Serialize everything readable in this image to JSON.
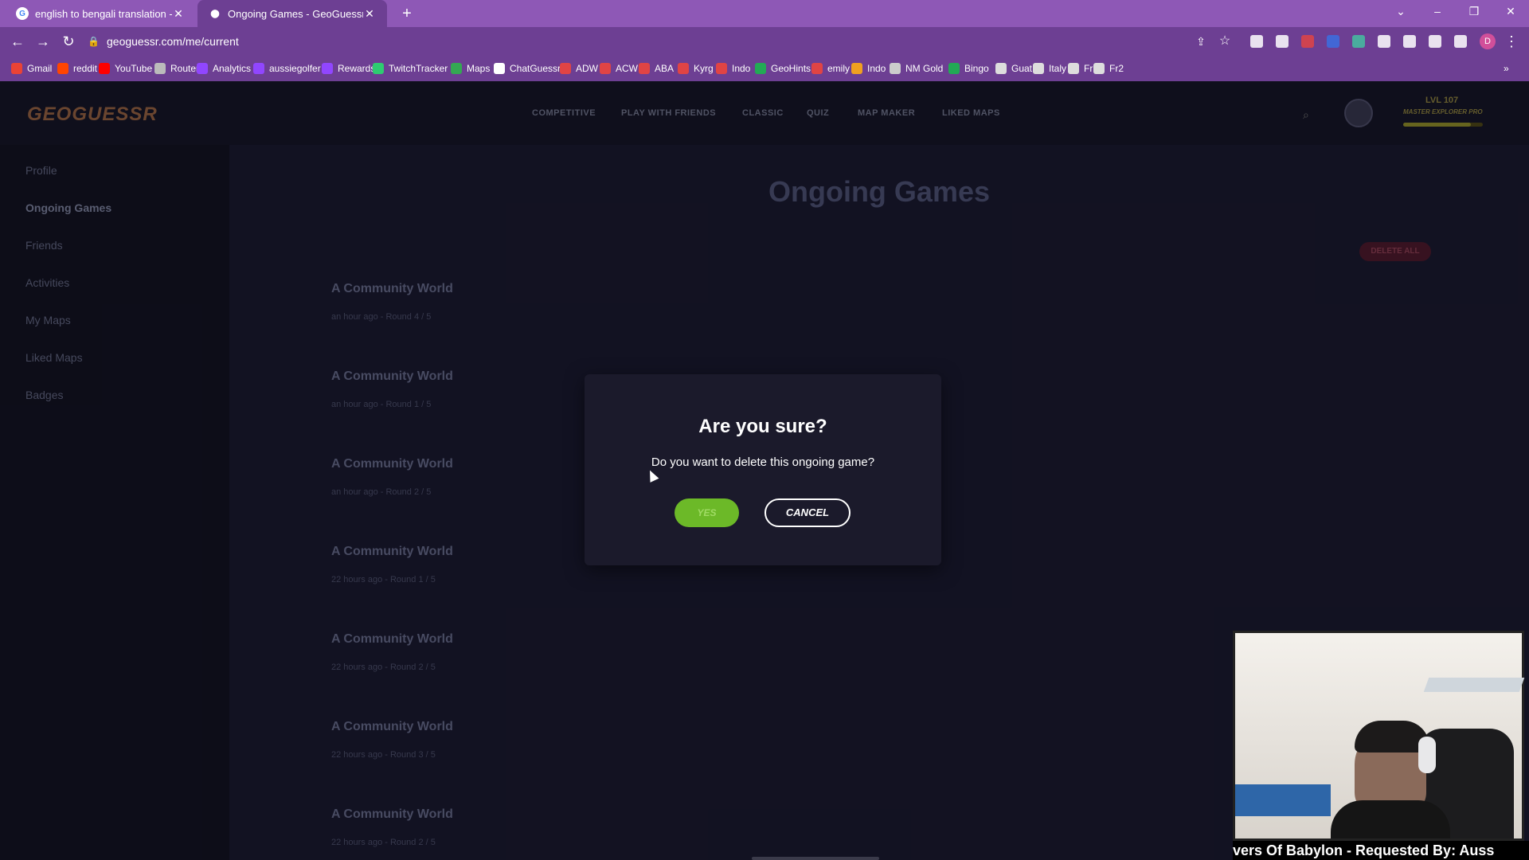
{
  "browser": {
    "tabs": [
      {
        "title": "english to bengali translation - G",
        "active": false,
        "favicon": "google-icon"
      },
      {
        "title": "Ongoing Games - GeoGuessr",
        "active": true,
        "favicon": "geoguessr-pin-icon"
      }
    ],
    "url": "geoguessr.com/me/current",
    "profile_initial": "D",
    "bookmarks": [
      "Gmail",
      "reddit",
      "YouTube",
      "Router",
      "Analytics",
      "aussiegolfer",
      "Rewards",
      "TwitchTracker",
      "Maps",
      "ChatGuessr",
      "ADW",
      "ACW",
      "ABA",
      "Kyrg",
      "Indo",
      "GeoHints",
      "emily",
      "Indo",
      "NM Gold",
      "Bingo",
      "Guat",
      "Italy",
      "Fr",
      "Fr2"
    ]
  },
  "site": {
    "logo": "GEOGUESSR",
    "nav": [
      "COMPETITIVE",
      "PLAY WITH FRIENDS",
      "CLASSIC",
      "QUIZ",
      "MAP MAKER",
      "LIKED MAPS"
    ],
    "level": "LVL 107",
    "rank": "MASTER EXPLORER PRO",
    "xp_progress": 0.85
  },
  "sidebar": {
    "items": [
      "Profile",
      "Ongoing Games",
      "Friends",
      "Activities",
      "My Maps",
      "Liked Maps",
      "Badges"
    ],
    "active": "Ongoing Games"
  },
  "main": {
    "title": "Ongoing Games",
    "delete_all": "DELETE ALL",
    "games": [
      {
        "title": "A Community World",
        "meta": "an hour ago - Round 4 / 5"
      },
      {
        "title": "A Community World",
        "meta": "an hour ago - Round 1 / 5"
      },
      {
        "title": "A Community World",
        "meta": "an hour ago - Round 2 / 5"
      },
      {
        "title": "A Community World",
        "meta": "22 hours ago - Round 1 / 5"
      },
      {
        "title": "A Community World",
        "meta": "22 hours ago - Round 2 / 5"
      },
      {
        "title": "A Community World",
        "meta": "22 hours ago - Round 3 / 5"
      },
      {
        "title": "A Community World",
        "meta": "22 hours ago - Round 2 / 5"
      }
    ]
  },
  "modal": {
    "title": "Are you sure?",
    "text": "Do you want to delete this ongoing game?",
    "yes": "YES",
    "cancel": "CANCEL"
  },
  "ticker": "vers Of Babylon - Requested By: Auss",
  "colors": {
    "tabbar": "#8e58b6",
    "yes_button": "#6cb928",
    "modal_bg": "#1b1a2b"
  }
}
